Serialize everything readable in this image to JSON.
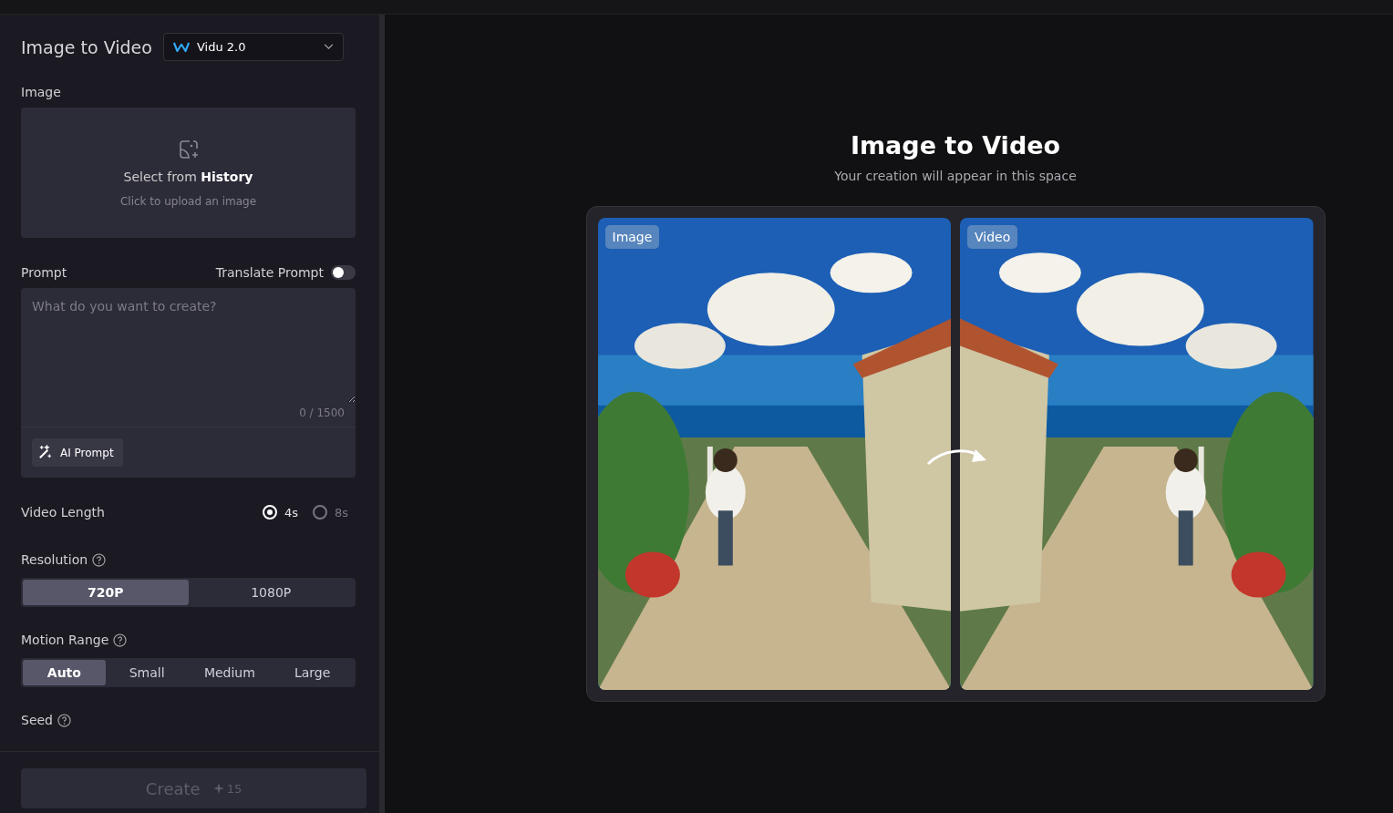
{
  "panel": {
    "title": "Image to Video",
    "model": {
      "label": "Vidu 2.0"
    },
    "image": {
      "label": "Image",
      "select_text": "Select from **History**",
      "hint": "Click to upload an image"
    },
    "prompt": {
      "label": "Prompt",
      "translate_label": "Translate Prompt",
      "translate_on": false,
      "placeholder": "What do you want to create?",
      "counter": "0 / 1500",
      "ai_button": "AI Prompt"
    },
    "video_length": {
      "label": "Video Length",
      "options": [
        {
          "label": "4s",
          "selected": true
        },
        {
          "label": "8s",
          "selected": false
        }
      ]
    },
    "resolution": {
      "label": "Resolution",
      "options": [
        {
          "label": "720P",
          "selected": true
        },
        {
          "label": "1080P",
          "selected": false
        }
      ]
    },
    "motion_range": {
      "label": "Motion Range",
      "options": [
        {
          "label": "Auto",
          "selected": true
        },
        {
          "label": "Small",
          "selected": false
        },
        {
          "label": "Medium",
          "selected": false
        },
        {
          "label": "Large",
          "selected": false
        }
      ]
    },
    "seed": {
      "label": "Seed"
    },
    "create": {
      "label": "Create",
      "cost": "15",
      "disabled": true
    }
  },
  "preview": {
    "title": "Image to Video",
    "subtitle": "Your creation will appear in this space",
    "panes": [
      {
        "badge": "Image",
        "kind": "picture"
      },
      {
        "badge": "Video",
        "kind": "picture"
      }
    ]
  }
}
